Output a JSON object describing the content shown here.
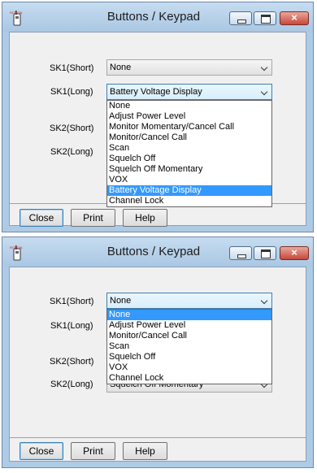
{
  "windows": [
    {
      "title": "Buttons / Keypad",
      "close_glyph": "×",
      "fields": [
        {
          "label": "SK1(Short)",
          "value": "None"
        },
        {
          "label": "SK1(Long)",
          "value": "Battery Voltage Display"
        },
        {
          "label": "SK2(Short)",
          "value": ""
        },
        {
          "label": "SK2(Long)",
          "value": ""
        }
      ],
      "dropdown": {
        "options": [
          "None",
          "Adjust Power Level",
          "Monitor Momentary/Cancel Call",
          "Monitor/Cancel Call",
          "Scan",
          "Squelch Off",
          "Squelch Off Momentary",
          "VOX",
          "Battery Voltage Display",
          "Channel Lock"
        ],
        "selected": "Battery Voltage Display"
      },
      "buttons": {
        "close": "Close",
        "print": "Print",
        "help": "Help"
      }
    },
    {
      "title": "Buttons / Keypad",
      "close_glyph": "×",
      "fields": [
        {
          "label": "SK1(Short)",
          "value": "None"
        },
        {
          "label": "SK1(Long)",
          "value": ""
        },
        {
          "label": "SK2(Short)",
          "value": ""
        },
        {
          "label": "SK2(Long)",
          "value": "Squelch Off Momentary"
        }
      ],
      "dropdown": {
        "options": [
          "None",
          "Adjust Power Level",
          "Monitor/Cancel Call",
          "Scan",
          "Squelch Off",
          "VOX",
          "Channel Lock"
        ],
        "selected": "None"
      },
      "buttons": {
        "close": "Close",
        "print": "Print",
        "help": "Help"
      }
    }
  ],
  "icon": "radio-app-icon"
}
